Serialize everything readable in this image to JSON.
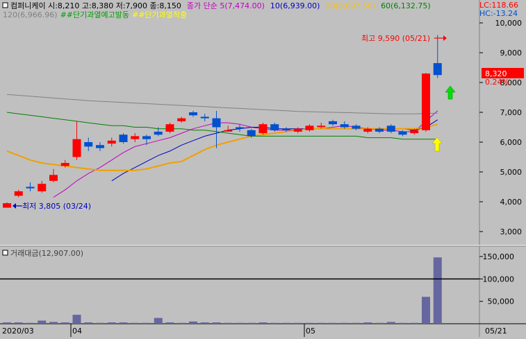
{
  "header": {
    "icon": "square-icon",
    "line1": [
      {
        "text": "컴퍼니케이 시:8,210 고:8,380 저:7,900 종:8,150",
        "color": "#000000"
      },
      {
        "text": "종가 단순 5(7,474.00)",
        "color": "#c000c0"
      },
      {
        "text": "10(6,939.00)",
        "color": "#0000c0"
      },
      {
        "text": "20(6,697.50)",
        "color": "#ffc000"
      },
      {
        "text": "60(6,132.75)",
        "color": "#008000"
      }
    ],
    "line2": [
      {
        "text": "120(6,966.96)",
        "color": "#808080"
      },
      {
        "text": "##단기과열예고발동",
        "color": "#00a000"
      },
      {
        "text": "##단기과열적출",
        "color": "#ffff00"
      }
    ],
    "lc_text": "LC:118.66",
    "hc_text": "HC:-13.24"
  },
  "price_axis": {
    "ticks": [
      {
        "value": 10000,
        "label": "10,000"
      },
      {
        "value": 9000,
        "label": "9,000"
      },
      {
        "value": 8000,
        "label": "8,000"
      },
      {
        "value": 7000,
        "label": "7,000"
      },
      {
        "value": 6000,
        "label": "6,000"
      },
      {
        "value": 5000,
        "label": "5,000"
      },
      {
        "value": 4000,
        "label": "4,000"
      },
      {
        "value": 3000,
        "label": "3,000"
      }
    ],
    "current_price_label": "8,320",
    "change_label": "0.24%"
  },
  "annotations": {
    "high": "최고 9,590 (05/21)",
    "low": "최저 3,805 (03/24)"
  },
  "volume_panel": {
    "title": "거래대금(12,907.00)",
    "ticks": [
      {
        "value": 150000,
        "label": "150,000"
      },
      {
        "value": 100000,
        "label": "100,000"
      },
      {
        "value": 50000,
        "label": "50,000"
      }
    ],
    "reference_line": 100000
  },
  "x_axis": {
    "labels": [
      "2020/03",
      "04",
      "05"
    ],
    "right_label": "05/21"
  },
  "colors": {
    "up": "#ff0000",
    "down": "#0050d0",
    "volume": "#6666a0",
    "signal_up": "#00e000",
    "signal_warn": "#ffff00"
  },
  "chart_data": {
    "type": "candlestick",
    "price_range": [
      2500,
      10500
    ],
    "volume_range": [
      0,
      160000
    ],
    "candles": [
      {
        "o": 3800,
        "c": 3950,
        "h": 3980,
        "l": 3805,
        "v": 3000
      },
      {
        "o": 4200,
        "c": 4350,
        "h": 4400,
        "l": 4150,
        "v": 3000
      },
      {
        "o": 4500,
        "c": 4450,
        "h": 4650,
        "l": 4350,
        "v": 2000
      },
      {
        "o": 4350,
        "c": 4600,
        "h": 4700,
        "l": 4300,
        "v": 7000
      },
      {
        "o": 4700,
        "c": 4900,
        "h": 5100,
        "l": 4650,
        "v": 4000
      },
      {
        "o": 5200,
        "c": 5300,
        "h": 5400,
        "l": 5150,
        "v": 3000
      },
      {
        "o": 5500,
        "c": 6100,
        "h": 6700,
        "l": 5400,
        "v": 20000
      },
      {
        "o": 6000,
        "c": 5850,
        "h": 6150,
        "l": 5700,
        "v": 3000
      },
      {
        "o": 5900,
        "c": 5800,
        "h": 6000,
        "l": 5700,
        "v": 2000
      },
      {
        "o": 5950,
        "c": 6050,
        "h": 6150,
        "l": 5850,
        "v": 3000
      },
      {
        "o": 6250,
        "c": 6000,
        "h": 6300,
        "l": 5950,
        "v": 3000
      },
      {
        "o": 6100,
        "c": 6200,
        "h": 6300,
        "l": 6000,
        "v": 2000
      },
      {
        "o": 6200,
        "c": 6100,
        "h": 6250,
        "l": 5900,
        "v": 2000
      },
      {
        "o": 6350,
        "c": 6250,
        "h": 6500,
        "l": 6200,
        "v": 13000
      },
      {
        "o": 6350,
        "c": 6600,
        "h": 6650,
        "l": 6300,
        "v": 3000
      },
      {
        "o": 6700,
        "c": 6800,
        "h": 6850,
        "l": 6650,
        "v": 2000
      },
      {
        "o": 7000,
        "c": 6900,
        "h": 7050,
        "l": 6850,
        "v": 5000
      },
      {
        "o": 6850,
        "c": 6800,
        "h": 6950,
        "l": 6700,
        "v": 3000
      },
      {
        "o": 6800,
        "c": 6500,
        "h": 7050,
        "l": 5800,
        "v": 3000
      },
      {
        "o": 6400,
        "c": 6400,
        "h": 6550,
        "l": 6350,
        "v": 2000
      },
      {
        "o": 6500,
        "c": 6450,
        "h": 6600,
        "l": 6350,
        "v": 2000
      },
      {
        "o": 6400,
        "c": 6200,
        "h": 6450,
        "l": 6150,
        "v": 2000
      },
      {
        "o": 6300,
        "c": 6600,
        "h": 6650,
        "l": 6250,
        "v": 3000
      },
      {
        "o": 6600,
        "c": 6400,
        "h": 6650,
        "l": 6350,
        "v": 2000
      },
      {
        "o": 6450,
        "c": 6400,
        "h": 6500,
        "l": 6350,
        "v": 2000
      },
      {
        "o": 6350,
        "c": 6450,
        "h": 6500,
        "l": 6300,
        "v": 2000
      },
      {
        "o": 6400,
        "c": 6550,
        "h": 6600,
        "l": 6350,
        "v": 2000
      },
      {
        "o": 6550,
        "c": 6550,
        "h": 6650,
        "l": 6450,
        "v": 2000
      },
      {
        "o": 6700,
        "c": 6600,
        "h": 6750,
        "l": 6550,
        "v": 2000
      },
      {
        "o": 6600,
        "c": 6500,
        "h": 6700,
        "l": 6450,
        "v": 2000
      },
      {
        "o": 6550,
        "c": 6450,
        "h": 6600,
        "l": 6400,
        "v": 2000
      },
      {
        "o": 6350,
        "c": 6450,
        "h": 6500,
        "l": 6300,
        "v": 3000
      },
      {
        "o": 6450,
        "c": 6350,
        "h": 6500,
        "l": 6300,
        "v": 2000
      },
      {
        "o": 6550,
        "c": 6350,
        "h": 6600,
        "l": 6300,
        "v": 4000
      },
      {
        "o": 6350,
        "c": 6250,
        "h": 6400,
        "l": 6200,
        "v": 2000
      },
      {
        "o": 6300,
        "c": 6400,
        "h": 6450,
        "l": 6250,
        "v": 2000
      },
      {
        "o": 6400,
        "c": 8300,
        "h": 8320,
        "l": 6350,
        "v": 60000
      },
      {
        "o": 8650,
        "c": 8250,
        "h": 9590,
        "l": 8150,
        "v": 148000
      }
    ],
    "ma": [
      {
        "period": 5,
        "color": "#c000c0",
        "values": [
          null,
          null,
          null,
          null,
          4150,
          4400,
          4700,
          4950,
          5150,
          5400,
          5650,
          5850,
          5950,
          6050,
          6150,
          6300,
          6450,
          6550,
          6650,
          6650,
          6600,
          6500,
          6450,
          6400,
          6400,
          6400,
          6450,
          6450,
          6500,
          6550,
          6500,
          6450,
          6400,
          6400,
          6350,
          6350,
          6700,
          7050
        ]
      },
      {
        "period": 10,
        "color": "#0000c0",
        "values": [
          null,
          null,
          null,
          null,
          null,
          null,
          null,
          null,
          null,
          4700,
          4950,
          5150,
          5350,
          5550,
          5700,
          5900,
          6050,
          6200,
          6300,
          6400,
          6450,
          6500,
          6500,
          6450,
          6450,
          6450,
          6450,
          6450,
          6450,
          6450,
          6450,
          6450,
          6450,
          6450,
          6450,
          6400,
          6500,
          6750
        ]
      },
      {
        "period": 20,
        "color": "#f0a000",
        "values": [
          5700,
          5550,
          5400,
          5300,
          5250,
          5200,
          5150,
          5100,
          5050,
          5050,
          5050,
          5050,
          5100,
          5200,
          5300,
          5350,
          5550,
          5750,
          5900,
          6000,
          6100,
          6200,
          6250,
          6300,
          6350,
          6400,
          6450,
          6450,
          6450,
          6450,
          6450,
          6450,
          6450,
          6450,
          6450,
          6450,
          6500,
          6600
        ]
      },
      {
        "period": 60,
        "color": "#008000",
        "values": [
          7000,
          6950,
          6900,
          6850,
          6800,
          6750,
          6700,
          6650,
          6600,
          6550,
          6550,
          6500,
          6500,
          6450,
          6450,
          6450,
          6400,
          6400,
          6350,
          6300,
          6250,
          6200,
          6200,
          6200,
          6200,
          6200,
          6200,
          6200,
          6200,
          6200,
          6200,
          6150,
          6150,
          6150,
          6100,
          6100,
          6100,
          6100
        ]
      },
      {
        "period": 120,
        "color": "#808080",
        "values": [
          7600,
          7570,
          7540,
          7510,
          7480,
          7450,
          7420,
          7390,
          7370,
          7350,
          7330,
          7310,
          7290,
          7270,
          7250,
          7230,
          7210,
          7190,
          7170,
          7150,
          7130,
          7110,
          7090,
          7070,
          7050,
          7030,
          7020,
          7010,
          7000,
          6990,
          6980,
          6970,
          6960,
          6950,
          6950,
          6950,
          6960,
          6970
        ]
      }
    ]
  }
}
